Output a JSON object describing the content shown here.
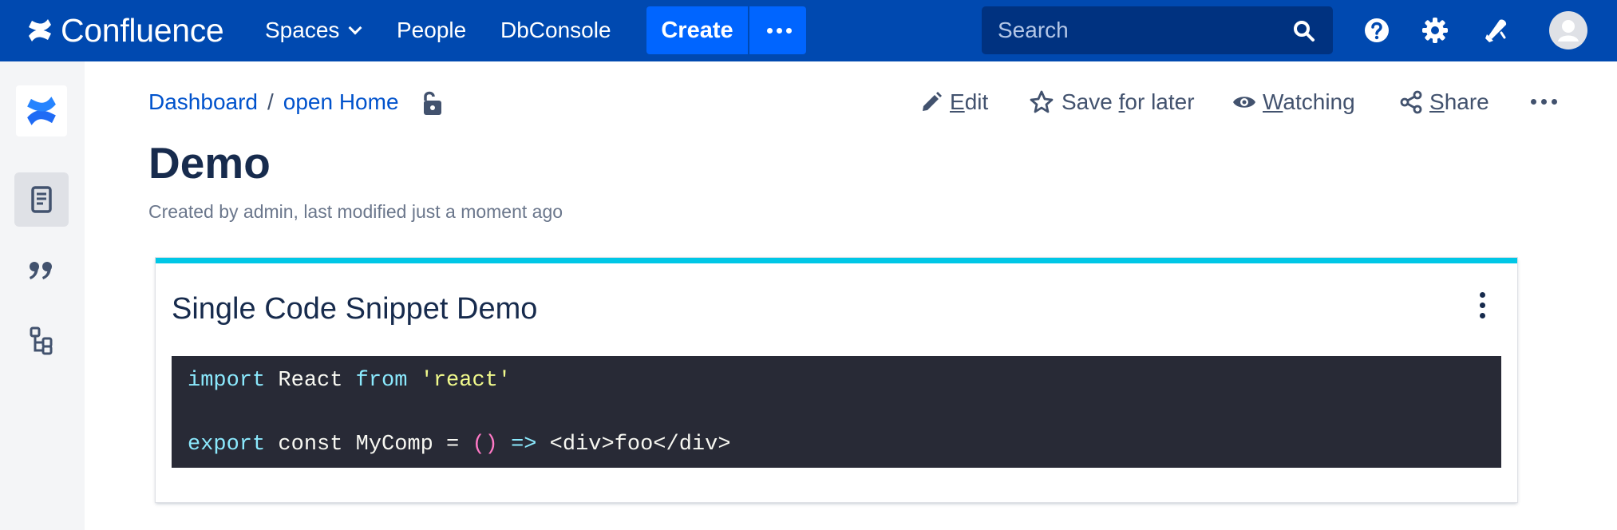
{
  "app": {
    "logo_text": "Confluence"
  },
  "nav": {
    "items": [
      {
        "label": "Spaces"
      },
      {
        "label": "People"
      },
      {
        "label": "DbConsole"
      }
    ],
    "create_label": "Create"
  },
  "search": {
    "placeholder": "Search"
  },
  "colors": {
    "nav_bg": "#0049b0",
    "create_bg": "#0065ff",
    "panel_accent": "#00c7e6",
    "code_bg": "#282a36",
    "link": "#0052cc"
  },
  "breadcrumb": [
    {
      "label": "Dashboard"
    },
    {
      "label": "open Home"
    }
  ],
  "breadcrumb_separator": "/",
  "page_actions": {
    "edit": {
      "first": "E",
      "rest": "dit"
    },
    "save": {
      "before": "Save ",
      "underlined": "f",
      "after": "or later"
    },
    "watch": {
      "first": "W",
      "rest": "atching"
    },
    "share": {
      "first": "S",
      "rest": "hare"
    }
  },
  "page": {
    "title": "Demo",
    "byline": "Created by admin, last modified just a moment ago"
  },
  "panel": {
    "title": "Single Code Snippet Demo"
  },
  "code": {
    "line1": {
      "kw1": "import",
      "t1": " React ",
      "kw2": "from",
      "t2": " ",
      "str": "'react'"
    },
    "line2": {
      "kw1": "export",
      "t1": " const MyComp = ",
      "paren": "()",
      "t2": " ",
      "arrow": "=>",
      "t3": " <div>foo</div>"
    }
  },
  "icons": [
    "confluence-logo-icon",
    "chevron-down-icon",
    "more-icon",
    "search-icon",
    "help-icon",
    "gear-icon",
    "notification-icon",
    "avatar-icon",
    "pages-icon",
    "blog-icon",
    "page-tree-icon",
    "unlock-icon",
    "pencil-icon",
    "star-icon",
    "eye-icon",
    "share-icon",
    "kebab-icon"
  ]
}
